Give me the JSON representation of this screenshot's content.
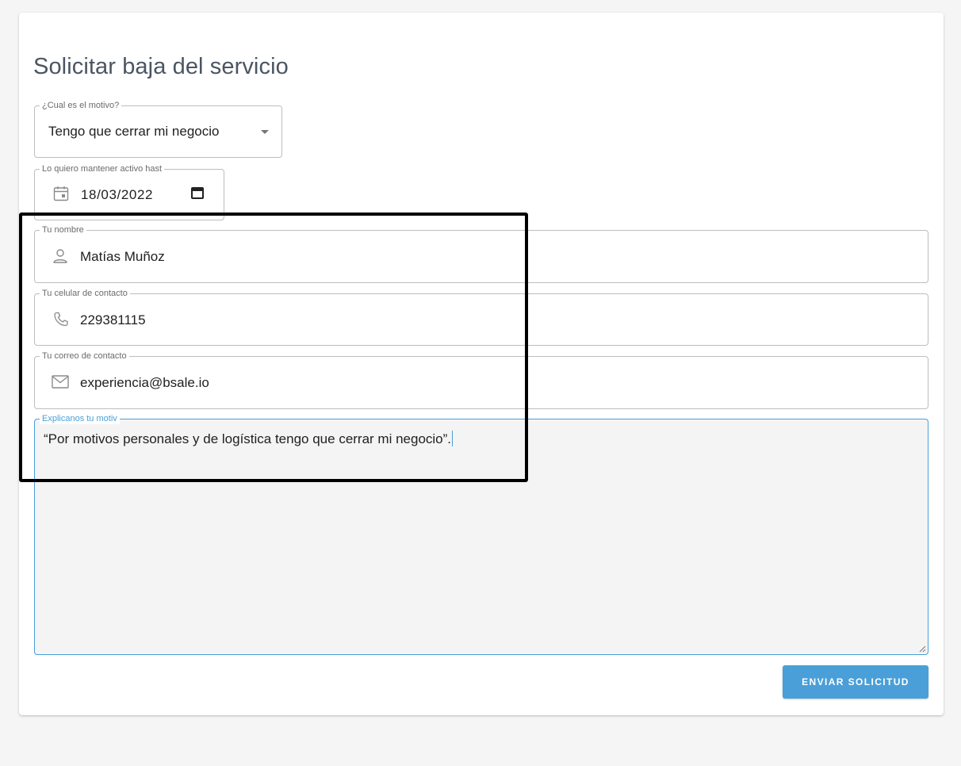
{
  "form": {
    "title": "Solicitar baja del servicio",
    "motivo": {
      "label": "¿Cual es el motivo?",
      "value": "Tengo que cerrar mi negocio"
    },
    "fecha": {
      "label": "Lo quiero mantener activo hast",
      "value": "18/03/2022"
    },
    "nombre": {
      "label": "Tu nombre",
      "value": "Matías Muñoz"
    },
    "celular": {
      "label": "Tu celular de contacto",
      "value": "229381115"
    },
    "correo": {
      "label": "Tu correo de contacto",
      "value": "experiencia@bsale.io"
    },
    "explicacion": {
      "label": "Explicanos tu motiv",
      "value": "“Por motivos personales y de logística tengo que cerrar mi negocio”."
    },
    "submit_label": "ENVIAR SOLICITUD"
  },
  "icons": {
    "motivo": "dropdown-arrow-icon",
    "fecha_start": "calendar-icon",
    "fecha_end": "calendar-picker-icon",
    "nombre": "person-icon",
    "celular": "phone-icon",
    "correo": "mail-icon"
  },
  "colors": {
    "accent": "#4a9fd8",
    "title": "#4b5563",
    "border": "#bdbdbd",
    "highlight": "#000000"
  }
}
